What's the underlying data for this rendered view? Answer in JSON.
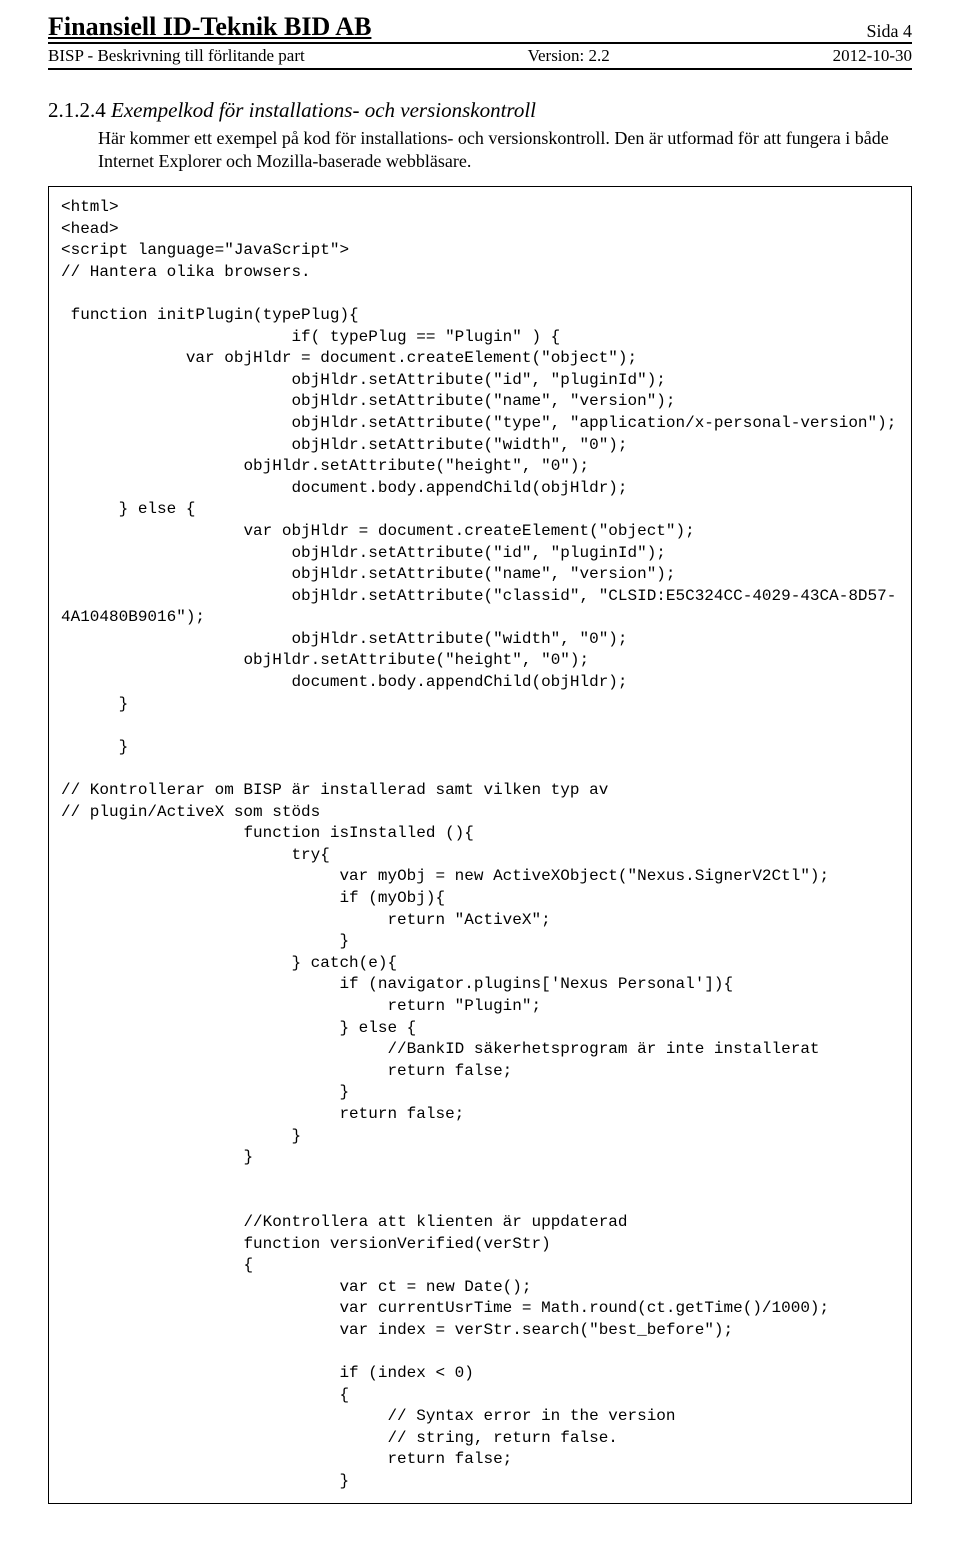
{
  "header": {
    "company": "Finansiell ID-Teknik BID AB",
    "page_label": "Sida 4",
    "doc_title": "BISP - Beskrivning till förlitande part",
    "version_label": "Version: 2.2",
    "date": "2012-10-30"
  },
  "section": {
    "number": "2.1.2.4",
    "title": "Exempelkod för installations- och versionskontroll",
    "paragraph": "Här kommer ett exempel på kod för installations- och versionskontroll. Den är utformad för att fungera i både Internet Explorer och Mozilla-baserade webbläsare."
  },
  "code": "<html>\n<head>\n<script language=\"JavaScript\">\n// Hantera olika browsers.\n\n function initPlugin(typePlug){\n                        if( typePlug == \"Plugin\" ) {\n             var objHldr = document.createElement(\"object\");\n                        objHldr.setAttribute(\"id\", \"pluginId\");\n                        objHldr.setAttribute(\"name\", \"version\");\n                        objHldr.setAttribute(\"type\", \"application/x-personal-version\");\n                        objHldr.setAttribute(\"width\", \"0\");\n                   objHldr.setAttribute(\"height\", \"0\");\n                        document.body.appendChild(objHldr);\n      } else {\n                   var objHldr = document.createElement(\"object\");\n                        objHldr.setAttribute(\"id\", \"pluginId\");\n                        objHldr.setAttribute(\"name\", \"version\");\n                        objHldr.setAttribute(\"classid\", \"CLSID:E5C324CC-4029-43CA-8D57-4A10480B9016\");\n                        objHldr.setAttribute(\"width\", \"0\");\n                   objHldr.setAttribute(\"height\", \"0\");\n                        document.body.appendChild(objHldr);\n      }\n\n      }\n\n// Kontrollerar om BISP är installerad samt vilken typ av\n// plugin/ActiveX som stöds\n                   function isInstalled (){\n                        try{\n                             var myObj = new ActiveXObject(\"Nexus.SignerV2Ctl\");\n                             if (myObj){\n                                  return \"ActiveX\";\n                             }\n                        } catch(e){\n                             if (navigator.plugins['Nexus Personal']){\n                                  return \"Plugin\";\n                             } else {\n                                  //BankID säkerhetsprogram är inte installerat\n                                  return false;\n                             }\n                             return false;\n                        }\n                   }\n\n\n                   //Kontrollera att klienten är uppdaterad\n                   function versionVerified(verStr)\n                   {\n                             var ct = new Date();\n                             var currentUsrTime = Math.round(ct.getTime()/1000);\n                             var index = verStr.search(\"best_before\");\n\n                             if (index < 0)\n                             {\n                                  // Syntax error in the version\n                                  // string, return false.\n                                  return false;\n                             }"
}
